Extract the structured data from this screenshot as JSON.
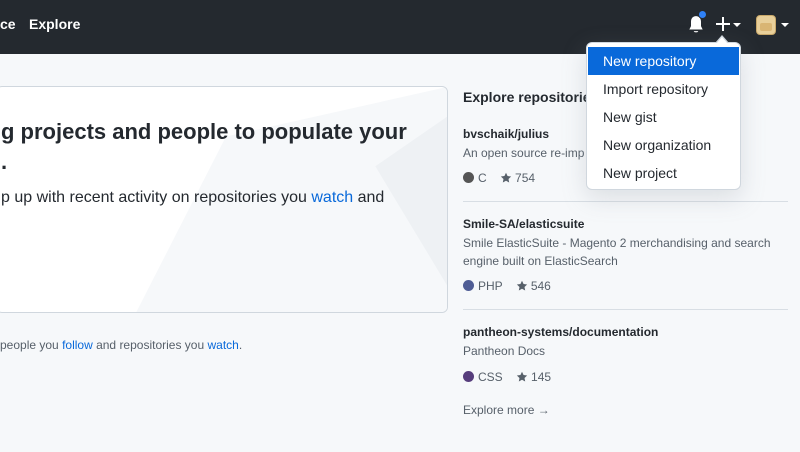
{
  "header": {
    "nav_partial": "ce",
    "explore": "Explore",
    "notification_icon": "bell-icon",
    "create_icon": "plus-icon",
    "avatar_icon": "user-avatar"
  },
  "create_menu": {
    "items": [
      {
        "label": "New repository",
        "active": true
      },
      {
        "label": "Import repository",
        "active": false
      },
      {
        "label": "New gist",
        "active": false
      },
      {
        "label": "New organization",
        "active": false
      },
      {
        "label": "New project",
        "active": false
      }
    ]
  },
  "main": {
    "headline_line1": "g projects and people to populate your",
    "headline_line2": ".",
    "sub_before": "p up with recent activity on repositories you ",
    "sub_link": "watch",
    "sub_after": " and",
    "footnote_before": "people you ",
    "footnote_follow": "follow",
    "footnote_mid": " and repositories you ",
    "footnote_watch": "watch",
    "footnote_after": "."
  },
  "explore": {
    "title": "Explore repositorie",
    "repos": [
      {
        "name": "bvschaik/julius",
        "description": "An open source re-imp",
        "language": "C",
        "lang_color": "#555555",
        "stars": "754"
      },
      {
        "name": "Smile-SA/elasticsuite",
        "description": "Smile ElasticSuite - Magento 2 merchandising and search engine built on ElasticSearch",
        "language": "PHP",
        "lang_color": "#4F5D95",
        "stars": "546"
      },
      {
        "name": "pantheon-systems/documentation",
        "description": "Pantheon Docs",
        "language": "CSS",
        "lang_color": "#563d7c",
        "stars": "145"
      }
    ],
    "more": "Explore more →"
  }
}
